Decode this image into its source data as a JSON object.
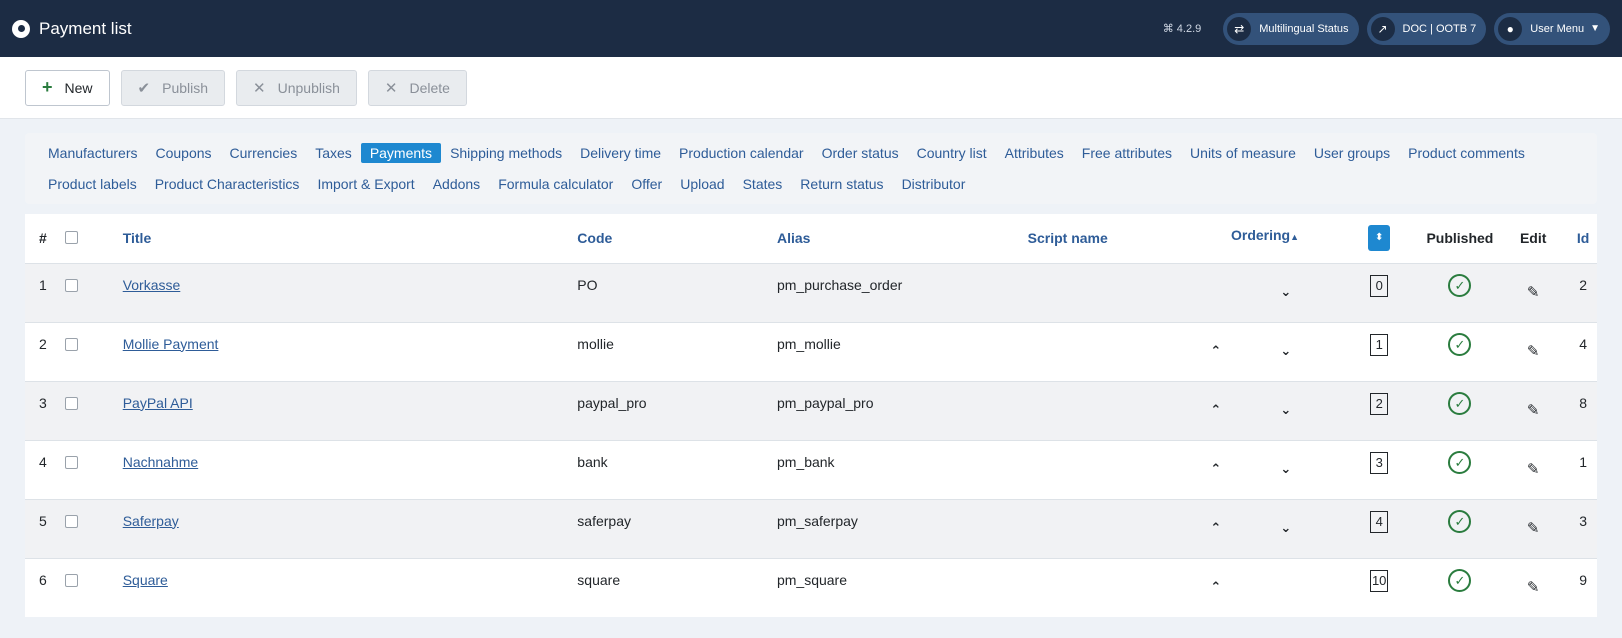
{
  "header": {
    "title": "Payment list",
    "version": "⌘ 4.2.9",
    "multilingual_label": "Multilingual Status",
    "doc_label": "DOC | OOTB 7",
    "user_menu_label": "User Menu"
  },
  "toolbar": {
    "new_label": "New",
    "publish_label": "Publish",
    "unpublish_label": "Unpublish",
    "delete_label": "Delete"
  },
  "submenu": [
    "Manufacturers",
    "Coupons",
    "Currencies",
    "Taxes",
    "Payments",
    "Shipping methods",
    "Delivery time",
    "Production calendar",
    "Order status",
    "Country list",
    "Attributes",
    "Free attributes",
    "Units of measure",
    "User groups",
    "Product comments",
    "Product labels",
    "Product Characteristics",
    "Import & Export",
    "Addons",
    "Formula calculator",
    "Offer",
    "Upload",
    "States",
    "Return status",
    "Distributor"
  ],
  "submenu_active": "Payments",
  "table": {
    "headers": {
      "num": "#",
      "title": "Title",
      "code": "Code",
      "alias": "Alias",
      "script": "Script name",
      "ordering": "Ordering",
      "published": "Published",
      "edit": "Edit",
      "id": "Id"
    },
    "rows": [
      {
        "num": "1",
        "title": "Vorkasse",
        "code": "PO",
        "alias": "pm_purchase_order",
        "script": "",
        "order": "0",
        "id": "2",
        "up": false,
        "down": true
      },
      {
        "num": "2",
        "title": "Mollie Payment",
        "code": "mollie",
        "alias": "pm_mollie",
        "script": "",
        "order": "1",
        "id": "4",
        "up": true,
        "down": true
      },
      {
        "num": "3",
        "title": "PayPal API",
        "code": "paypal_pro",
        "alias": "pm_paypal_pro",
        "script": "",
        "order": "2",
        "id": "8",
        "up": true,
        "down": true
      },
      {
        "num": "4",
        "title": "Nachnahme",
        "code": "bank",
        "alias": "pm_bank",
        "script": "",
        "order": "3",
        "id": "1",
        "up": true,
        "down": true
      },
      {
        "num": "5",
        "title": "Saferpay",
        "code": "saferpay",
        "alias": "pm_saferpay",
        "script": "",
        "order": "4",
        "id": "3",
        "up": true,
        "down": true
      },
      {
        "num": "6",
        "title": "Square",
        "code": "square",
        "alias": "pm_square",
        "script": "",
        "order": "10",
        "id": "9",
        "up": true,
        "down": false
      }
    ]
  }
}
